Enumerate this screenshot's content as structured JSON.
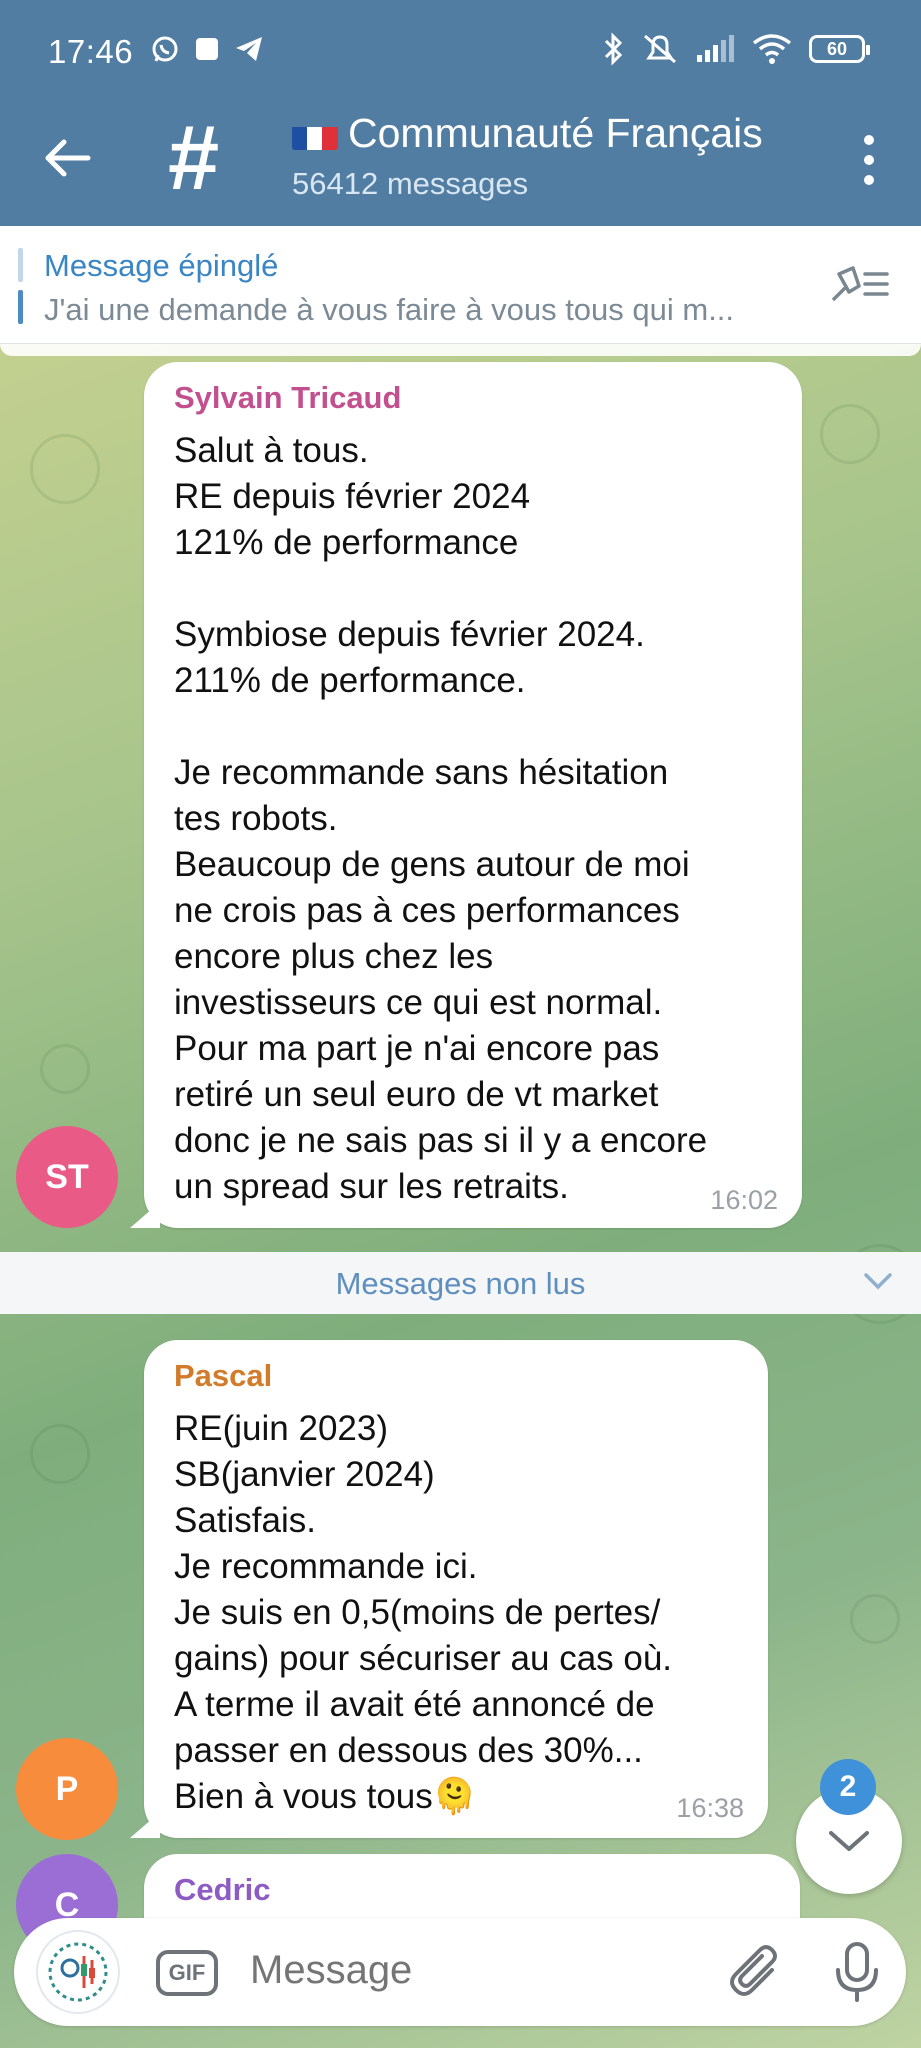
{
  "status_bar": {
    "time": "17:46",
    "battery": "60"
  },
  "header": {
    "title": "Communauté Français",
    "subtitle": "56412 messages"
  },
  "pinned": {
    "title": "Message épinglé",
    "text": "J'ai une demande à vous faire à vous tous qui m..."
  },
  "messages": [
    {
      "sender": "Sylvain Tricaud",
      "sender_color": "#c2508e",
      "avatar_initials": "ST",
      "avatar_color": "#ea5a86",
      "text": "Salut à tous.\nRE depuis février 2024\n121% de performance\n\nSymbiose depuis février 2024.\n211% de performance.\n\nJe recommande sans hésitation\ntes robots.\nBeaucoup de gens autour de moi\nne crois pas à ces performances\nencore plus chez les\ninvestisseurs ce qui est normal.\nPour ma part je n'ai encore pas\nretiré un seul euro de vt market\ndonc je ne sais pas si il y a encore\nun spread sur les retraits.",
      "time": "16:02"
    },
    {
      "sender": "Pascal",
      "sender_color": "#d27b2a",
      "avatar_initials": "P",
      "avatar_color": "#f68c3c",
      "text": "RE(juin 2023)\nSB(janvier 2024)\nSatisfais.\nJe recommande ici.\nJe suis en 0,5(moins de pertes/\ngains) pour sécuriser au cas où.\nA terme il avait été annoncé de\npasser en dessous des 30%...\nBien à vous tous🫠",
      "time": "16:38"
    },
    {
      "sender": "Cedric",
      "sender_color": "#8e5bc4",
      "avatar_initials": "C",
      "avatar_color": "#9b6ed6"
    }
  ],
  "unread_divider": "Messages non lus",
  "scroll_badge": "2",
  "composer": {
    "gif_label": "GIF",
    "placeholder": "Message"
  },
  "colors": {
    "header_bg": "#517da2",
    "accent": "#3a85c6"
  },
  "icons": [
    "back-arrow-icon",
    "hash-icon",
    "more-vertical-icon",
    "unpin-list-icon",
    "chevron-down-icon",
    "attach-icon",
    "microphone-icon"
  ]
}
